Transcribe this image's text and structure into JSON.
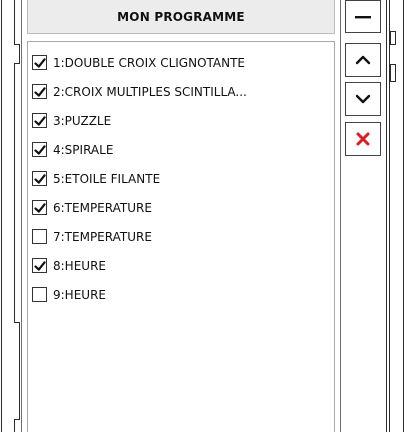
{
  "panel": {
    "title": "MON PROGRAMME"
  },
  "programs": [
    {
      "label": "1:DOUBLE CROIX CLIGNOTANTE",
      "checked": true
    },
    {
      "label": "2:CROIX MULTIPLES SCINTILLA...",
      "checked": true
    },
    {
      "label": "3:PUZZLE",
      "checked": true
    },
    {
      "label": "4:SPIRALE",
      "checked": true
    },
    {
      "label": "5:ETOILE FILANTE",
      "checked": true
    },
    {
      "label": "6:TEMPERATURE",
      "checked": true
    },
    {
      "label": "7:TEMPERATURE",
      "checked": false
    },
    {
      "label": "8:HEURE",
      "checked": true
    },
    {
      "label": "9:HEURE",
      "checked": false
    }
  ],
  "toolbar": {
    "buttons": [
      {
        "name": "collapse-button",
        "icon": "minus-icon"
      },
      {
        "name": "move-up-button",
        "icon": "chevron-up-icon"
      },
      {
        "name": "move-down-button",
        "icon": "chevron-down-icon"
      },
      {
        "name": "delete-button",
        "icon": "close-icon",
        "color": "#e01b1b"
      }
    ]
  },
  "colors": {
    "header_bg": "#ececec",
    "delete_red": "#e01b1b",
    "text": "#111111"
  }
}
